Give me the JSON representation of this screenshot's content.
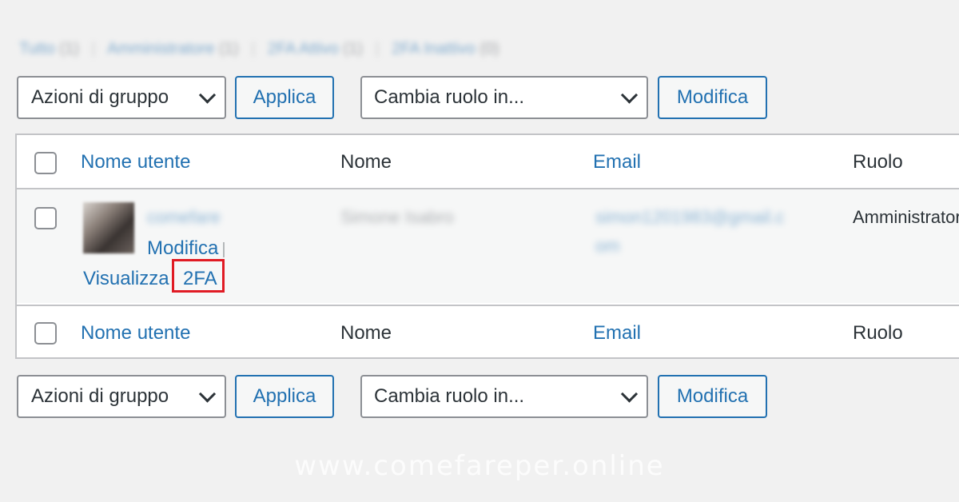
{
  "filters": [
    {
      "label": "Tutto",
      "count": "(1)"
    },
    {
      "label": "Amministratore",
      "count": "(1)"
    },
    {
      "label": "2FA Attivo",
      "count": "(1)"
    },
    {
      "label": "2FA Inattivo",
      "count": "(0)"
    }
  ],
  "toolbar": {
    "bulk_actions": "Azioni di gruppo",
    "apply": "Applica",
    "change_role": "Cambia ruolo in...",
    "change": "Modifica"
  },
  "table": {
    "headers": {
      "username": "Nome utente",
      "name": "Nome",
      "email": "Email",
      "role": "Ruolo"
    },
    "row": {
      "username": "comefare",
      "name": "Simone Isabro",
      "email_line1": "simon1201983@gmail.c",
      "email_line2": "om",
      "role": "Amministratore",
      "actions": {
        "edit": "Modifica",
        "view": "Visualizza",
        "twofa": "2FA"
      }
    }
  },
  "watermark": "www.comefareper.online",
  "colors": {
    "link": "#2271b1",
    "highlight": "#e01b24",
    "background": "#f1f1f1"
  }
}
